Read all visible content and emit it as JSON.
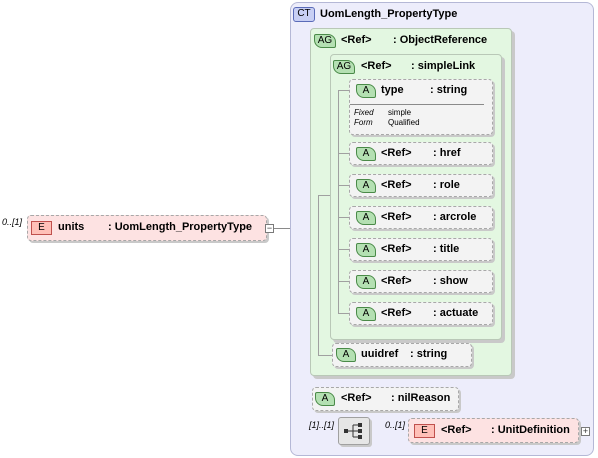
{
  "complex_type": {
    "badge": "CT",
    "name": "UomLength_PropertyType"
  },
  "root_element": {
    "cardinality": "0..[1]",
    "badge": "E",
    "name": "units",
    "type": ": UomLength_PropertyType"
  },
  "attribute_group_outer": {
    "badge": "AG",
    "name": "<Ref>",
    "type": ": ObjectReference"
  },
  "attribute_group_inner": {
    "badge": "AG",
    "name": "<Ref>",
    "type": ": simpleLink"
  },
  "type_attribute": {
    "badge": "A",
    "name": "type",
    "type": ": string",
    "fixed_label": "Fixed",
    "fixed_value": "simple",
    "form_label": "Form",
    "form_value": "Qualified"
  },
  "link_attributes": [
    {
      "badge": "A",
      "name": "<Ref>",
      "type": ": href"
    },
    {
      "badge": "A",
      "name": "<Ref>",
      "type": ": role"
    },
    {
      "badge": "A",
      "name": "<Ref>",
      "type": ": arcrole"
    },
    {
      "badge": "A",
      "name": "<Ref>",
      "type": ": title"
    },
    {
      "badge": "A",
      "name": "<Ref>",
      "type": ": show"
    },
    {
      "badge": "A",
      "name": "<Ref>",
      "type": ": actuate"
    }
  ],
  "uuidref_attribute": {
    "badge": "A",
    "name": "uuidref",
    "type": ": string"
  },
  "nilreason_attribute": {
    "badge": "A",
    "name": "<Ref>",
    "type": ": nilReason"
  },
  "sequence": {
    "cardinality": "[1]..[1]"
  },
  "child_element": {
    "cardinality": "0..[1]",
    "badge": "E",
    "name": "<Ref>",
    "type": ": UnitDefinition"
  },
  "colors": {
    "complex_type_bg": "#ededfb",
    "attribute_group_bg": "#e3f7e1",
    "element_bg": "#fde2e2",
    "attribute_bg": "#f3f3f3"
  }
}
